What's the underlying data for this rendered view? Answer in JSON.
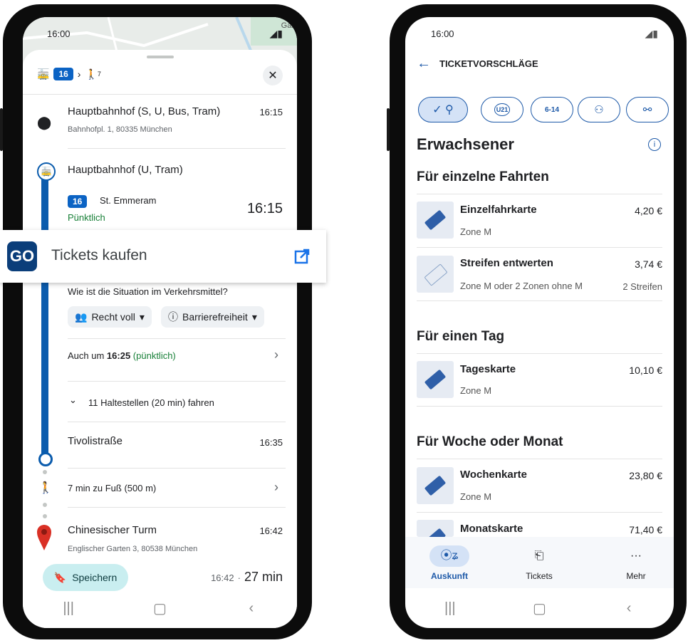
{
  "left": {
    "status_time": "16:00",
    "map_label": "Gar",
    "route_line": "16",
    "route_walk_sub": "7",
    "close_icon": "close-icon",
    "stops": [
      {
        "name": "Hauptbahnhof (S, U, Bus, Tram)",
        "time": "16:15",
        "address": "Bahnhofpl. 1, 80335 München"
      },
      {
        "name": "Hauptbahnhof (U, Tram)"
      }
    ],
    "departure": {
      "line": "16",
      "direction": "St. Emmeram",
      "status": "Pünktlich",
      "time": "16:15"
    },
    "popout": {
      "logo": "GO",
      "label": "Tickets kaufen",
      "icon": "open-external-icon"
    },
    "crowd_question": "Wie ist die Situation im Verkehrsmittel?",
    "chips": [
      {
        "label": "Recht voll"
      },
      {
        "label": "Barrierefreiheit"
      }
    ],
    "also": {
      "prefix": "Auch um ",
      "time": "16:25",
      "status": "(pünktlich)"
    },
    "stops_summary": "11 Haltestellen (20 min) fahren",
    "tivoli": {
      "name": "Tivolistraße",
      "time": "16:35"
    },
    "walk": "7 min zu Fuß (500 m)",
    "destination": {
      "name": "Chinesischer Turm",
      "time": "16:42",
      "address": "Englischer Garten 3, 80538 München"
    },
    "save_label": "Speichern",
    "arrival": {
      "time": "16:42",
      "sep": "·",
      "duration": "27 min"
    }
  },
  "right": {
    "status_time": "16:00",
    "header_title": "TICKETVORSCHLÄGE",
    "filters": [
      "check-user-icon",
      "u21-icon",
      "kids-6-14-icon",
      "group-icon",
      "bike-icon"
    ],
    "filter_texts": {
      "u21": "U21",
      "kids": "6-14"
    },
    "profile_title": "Erwachsener",
    "sections": [
      {
        "title": "Für einzelne Fahrten",
        "items": [
          {
            "name": "Einzelfahrkarte",
            "price": "4,20 €",
            "zone": "Zone M",
            "extra": ""
          },
          {
            "name": "Streifen entwerten",
            "price": "3,74 €",
            "zone": "Zone M oder 2 Zonen ohne M",
            "extra": "2 Streifen"
          }
        ]
      },
      {
        "title": "Für einen Tag",
        "items": [
          {
            "name": "Tageskarte",
            "price": "10,10 €",
            "zone": "Zone M",
            "extra": ""
          }
        ]
      },
      {
        "title": "Für Woche oder Monat",
        "items": [
          {
            "name": "Wochenkarte",
            "price": "23,80 €",
            "zone": "Zone M",
            "extra": ""
          },
          {
            "name": "Monatskarte",
            "price": "71,40 €",
            "zone": "",
            "extra": ""
          }
        ]
      }
    ],
    "bottom_nav": [
      {
        "label": "Auskunft",
        "icon": "route-icon"
      },
      {
        "label": "Tickets",
        "icon": "ticket-icon"
      },
      {
        "label": "Mehr",
        "icon": "more-icon"
      }
    ],
    "accent": "#1d59a8"
  }
}
